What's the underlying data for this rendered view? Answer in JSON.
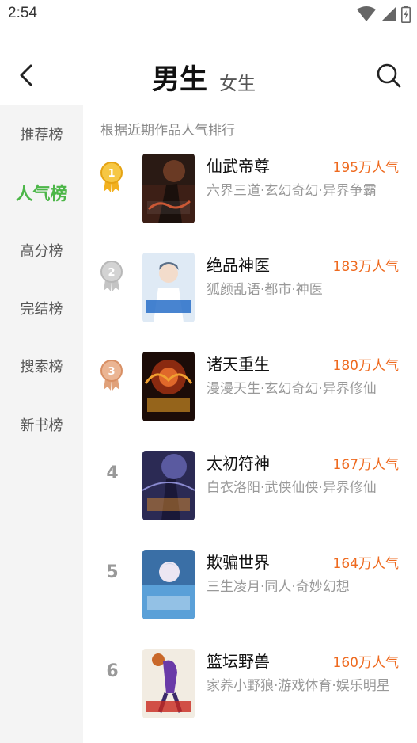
{
  "status": {
    "time": "2:54"
  },
  "header": {
    "tab_active": "男生",
    "tab_inactive": "女生"
  },
  "sidebar": {
    "items": [
      {
        "label": "推荐榜",
        "active": false
      },
      {
        "label": "人气榜",
        "active": true
      },
      {
        "label": "高分榜",
        "active": false
      },
      {
        "label": "完结榜",
        "active": false
      },
      {
        "label": "搜索榜",
        "active": false
      },
      {
        "label": "新书榜",
        "active": false
      }
    ]
  },
  "list": {
    "subtitle": "根据近期作品人气排行",
    "books": [
      {
        "rank": "1",
        "title": "仙武帝尊",
        "popularity": "195万人气",
        "meta": "六界三道·玄幻奇幻·异界争霸"
      },
      {
        "rank": "2",
        "title": "绝品神医",
        "popularity": "183万人气",
        "meta": "狐颜乱语·都市·神医"
      },
      {
        "rank": "3",
        "title": "诸天重生",
        "popularity": "180万人气",
        "meta": "漫漫天生·玄幻奇幻·异界修仙"
      },
      {
        "rank": "4",
        "title": "太初符神",
        "popularity": "167万人气",
        "meta": "白衣洛阳·武侠仙侠·异界修仙"
      },
      {
        "rank": "5",
        "title": "欺骗世界",
        "popularity": "164万人气",
        "meta": "三生凌月·同人·奇妙幻想"
      },
      {
        "rank": "6",
        "title": "篮坛野兽",
        "popularity": "160万人气",
        "meta": "家养小野狼·游戏体育·娱乐明星"
      }
    ]
  },
  "colors": {
    "accent": "#4cb648",
    "popularity": "#ee6a1f",
    "gold": "#f2b01e",
    "silver": "#c4c4c4",
    "bronze": "#e0a17a"
  }
}
